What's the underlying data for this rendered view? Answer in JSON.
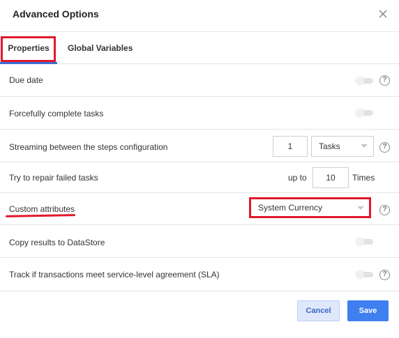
{
  "dialog": {
    "title": "Advanced Options",
    "close_icon": "close-icon"
  },
  "tabs": [
    {
      "label": "Properties",
      "active": true
    },
    {
      "label": "Global Variables",
      "active": false
    }
  ],
  "rows": {
    "due_date": {
      "label": "Due date",
      "toggle_on": false,
      "help": "?"
    },
    "forcefully_complete": {
      "label": "Forcefully complete tasks",
      "toggle_on": false
    },
    "streaming": {
      "label": "Streaming between the steps configuration",
      "count_value": "1",
      "unit_selected": "Tasks",
      "help": "?"
    },
    "repair": {
      "label": "Try to repair failed tasks",
      "prefix": "up to",
      "count_value": "10",
      "suffix": "Times"
    },
    "custom_attributes": {
      "label": "Custom attributes",
      "selected": "System Currency",
      "help": "?"
    },
    "copy_results": {
      "label": "Copy results to DataStore",
      "toggle_on": false
    },
    "sla": {
      "label": "Track if transactions meet service-level agreement (SLA)",
      "toggle_on": false,
      "help": "?"
    }
  },
  "footer": {
    "cancel_label": "Cancel",
    "save_label": "Save"
  },
  "colors": {
    "accent": "#3f7fef",
    "annotation_red": "#e0182d",
    "tab_underline": "#3b6fd4"
  }
}
